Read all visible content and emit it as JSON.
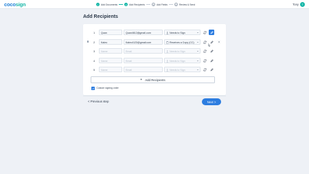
{
  "app": {
    "logo_main": "coco",
    "logo_accent": "sign",
    "user_name": "Tony",
    "user_initial": "T"
  },
  "steps": [
    {
      "number": "1",
      "label": "Add Documents",
      "status": "done"
    },
    {
      "number": "2",
      "label": "Add Recipients",
      "status": "current"
    },
    {
      "number": "3",
      "label": "Add Fields",
      "status": "pending"
    },
    {
      "number": "4",
      "label": "Review & Send",
      "status": "pending"
    }
  ],
  "page": {
    "title": "Add Recipients"
  },
  "recipients": [
    {
      "number": "1",
      "name": "Quan",
      "email": "Quan4612@gmail.com",
      "role": "Needs to Sign",
      "empty": false
    },
    {
      "number": "2",
      "name": "Kaleo",
      "email": "Kaleo4123@gmail.com",
      "role": "Receives a Copy (CC)",
      "empty": false
    },
    {
      "number": "3",
      "name": "Name",
      "email": "Email",
      "role": "Needs to Sign",
      "empty": true
    },
    {
      "number": "4",
      "name": "Name",
      "email": "Email",
      "role": "Needs to Sign",
      "empty": true
    },
    {
      "number": "5",
      "name": "Name",
      "email": "Email",
      "role": "Needs to Sign",
      "empty": true
    }
  ],
  "actions": {
    "add_recipients_label": "Add Recipients",
    "add_icon": "plus-icon",
    "custom_order_label": "Custom signing order",
    "custom_order_checked": true,
    "previous_label": "< Previous step",
    "next_label": "Next >"
  },
  "colors": {
    "brand_blue": "#1e7fd8",
    "brand_teal": "#18b7a8",
    "primary_button": "#2d7de0",
    "background": "#eef1f6"
  },
  "icons": {
    "sync": "sync-icon",
    "edit": "pen-icon",
    "remove": "close-icon",
    "signer": "person-icon",
    "cc": "copy-icon",
    "drag": "drag-handle-icon"
  }
}
